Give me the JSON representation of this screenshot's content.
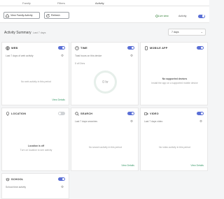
{
  "nav": {
    "tabs": [
      "Family",
      "Filters",
      "Activity"
    ]
  },
  "toolbar": {
    "btn_a": "View Family Activity",
    "btn_b": "Refresh",
    "live_a": "Live view",
    "live_b": "Activity"
  },
  "heading": {
    "title": "Activity Summary",
    "subtitle": "Last 7 days"
  },
  "range": {
    "selected": "7 days"
  },
  "cards": {
    "web": {
      "title": "WEB",
      "sub": "Last 7 days of web activity",
      "empty": "No web activity in this period",
      "link": "View Details"
    },
    "time": {
      "title": "TIME",
      "sub": "Total hours on this device",
      "status": "0 of 0 hrs",
      "ring": "0 hr"
    },
    "mobile": {
      "title": "MOBILE APP",
      "empty_b": "No supported devices",
      "empty": "Install the app on a supported mobile device"
    },
    "location": {
      "title": "LOCATION",
      "empty_b": "Location is off",
      "empty": "Turn on location to see activity"
    },
    "search": {
      "title": "SEARCH",
      "sub": "Last 7 days searches",
      "empty": "No search activity in this period",
      "link": "View Details"
    },
    "video": {
      "title": "VIDEO",
      "sub": "Last 7 days video",
      "empty": "No video activity in this period",
      "link": "View Details"
    },
    "school": {
      "title": "SCHOOL",
      "sub": "School time activity"
    }
  },
  "colors": {
    "accent": "#5a6fd6",
    "link": "#3a9a6a",
    "live": "#2e7d32"
  }
}
